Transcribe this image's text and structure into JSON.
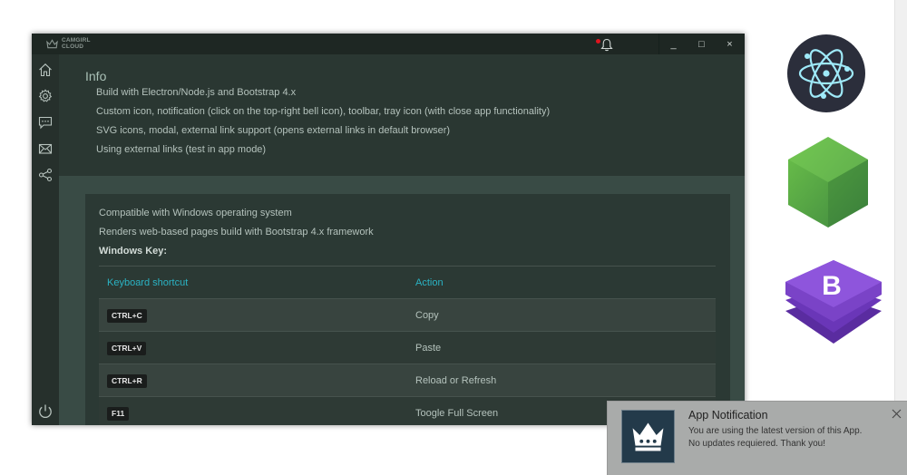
{
  "window": {
    "brand_top": "CAMGIRL",
    "brand_bottom": "CLOUD",
    "controls": {
      "minimize": "_",
      "maximize": "□",
      "close": "×"
    }
  },
  "sidebar": {
    "icons": [
      "home-icon",
      "gear-icon",
      "chat-icon",
      "mail-icon",
      "share-icon",
      "power-icon"
    ]
  },
  "info": {
    "title": "Info",
    "lines": [
      "Build with Electron/Node.js and Bootstrap 4.x",
      "Custom icon, notification (click on the top-right bell icon), toolbar, tray icon (with close app functionality)",
      "SVG icons, modal, external link support (opens external links in default browser)",
      "Using external links (test in app mode)"
    ]
  },
  "card": {
    "lines": [
      "Compatible with Windows operating system",
      "Renders web-based pages build with Bootstrap 4.x framework"
    ],
    "windows_key_label": "Windows Key:",
    "table": {
      "headers": [
        "Keyboard shortcut",
        "Action"
      ],
      "rows": [
        {
          "key": "CTRL+C",
          "action": "Copy"
        },
        {
          "key": "CTRL+V",
          "action": "Paste"
        },
        {
          "key": "CTRL+R",
          "action": "Reload or Refresh"
        },
        {
          "key": "F11",
          "action": "Toogle Full Screen"
        }
      ]
    }
  },
  "notification": {
    "title": "App Notification",
    "line1": "You are using the latest version of this App.",
    "line2": "No updates requiered.  Thank you!"
  },
  "colors": {
    "accent": "#2bb3c4",
    "bell_dot": "#e0141e",
    "node_green": "#5aa749",
    "bootstrap_purple": "#7a43c7",
    "electron_blue": "#9feaf9"
  }
}
